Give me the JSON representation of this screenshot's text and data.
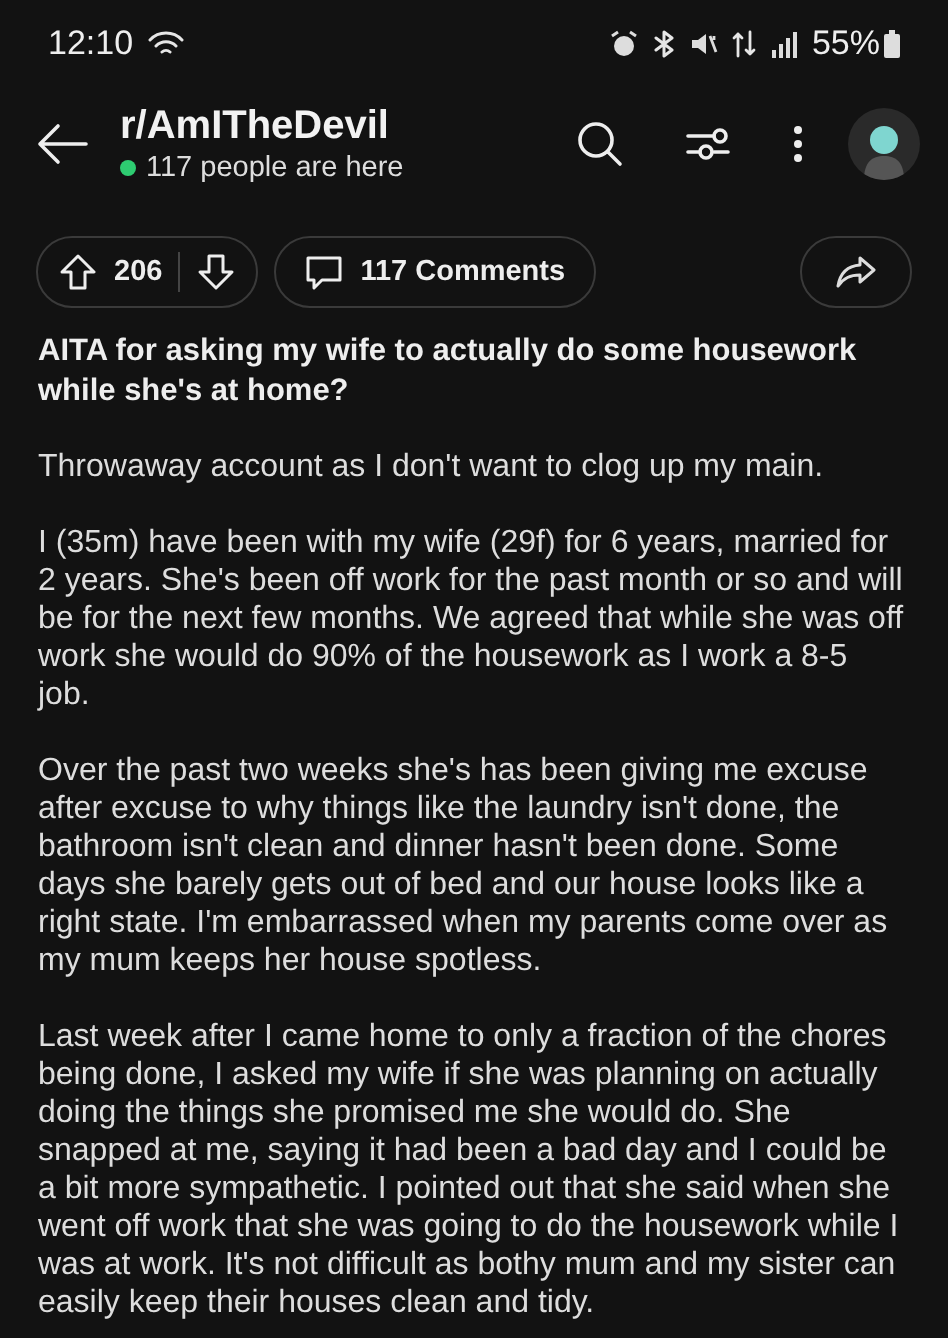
{
  "status_bar": {
    "time": "12:10",
    "battery": "55%"
  },
  "header": {
    "subreddit": "r/AmITheDevil",
    "online": "117 people are here"
  },
  "actions": {
    "votes": "206",
    "comments": "117 Comments"
  },
  "post": {
    "title": "AITA for asking my wife to actually do some housework while she's at home?",
    "paragraphs": [
      "Throwaway account as I don't want to clog up my main.",
      "I (35m) have been with my wife (29f) for 6 years, married for 2 years. She's been off work for the past month or so and will be for the next few months. We agreed that while she was off work she would do 90% of the housework as I work a 8-5 job.",
      "Over the past two weeks she's has been giving me excuse after excuse to why things like the laundry isn't done, the bathroom isn't clean and dinner hasn't been done. Some days she barely gets out of bed and our house looks like a right state. I'm embarrassed when my parents come over as my mum keeps her house spotless.",
      "Last week after I came home to only a fraction of the chores being done, I asked my wife if she was planning on actually doing the things she promised me she would do. She snapped at me, saying it had been a bad day and I could be a bit more sympathetic. I pointed out that she said when she went off work that she was going to do the housework while I was at work. It's not difficult as bothy mum and my sister can easily keep their houses clean and tidy."
    ]
  }
}
